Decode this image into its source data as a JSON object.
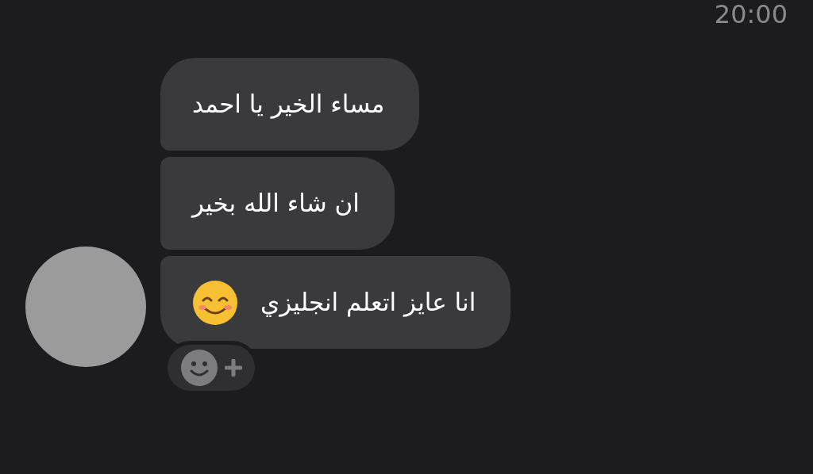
{
  "timestamp": "20:00",
  "messages": [
    {
      "text": "مساء الخير يا احمد",
      "has_emoji": false
    },
    {
      "text": "ان شاء الله بخير",
      "has_emoji": false
    },
    {
      "text": "انا عايز اتعلم انجليزي",
      "has_emoji": true
    }
  ]
}
